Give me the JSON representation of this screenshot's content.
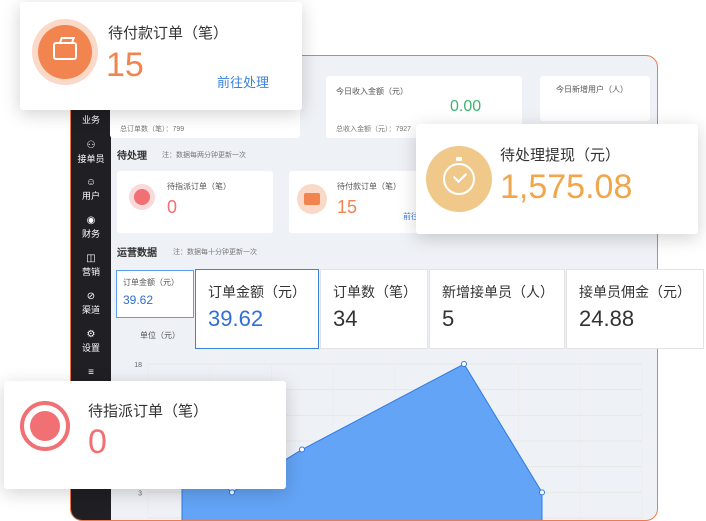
{
  "sidebar": {
    "items": [
      {
        "label": "业务",
        "glyph": "▣"
      },
      {
        "label": "接单员",
        "glyph": "⚇"
      },
      {
        "label": "用户",
        "glyph": "☺"
      },
      {
        "label": "财务",
        "glyph": "◉"
      },
      {
        "label": "营销",
        "glyph": "◫"
      },
      {
        "label": "渠道",
        "glyph": "⊘"
      },
      {
        "label": "设置",
        "glyph": "⚙"
      },
      {
        "label": "",
        "glyph": "≡"
      }
    ]
  },
  "top_stats": {
    "today_income_label": "今日收入金额（元）",
    "today_income_value": "0.00",
    "total_income_label": "总收入金额（元）：7927",
    "total_orders_label": "总订单数（笔）：799",
    "new_users_label": "今日新增用户（人）"
  },
  "pending": {
    "title": "待处理",
    "note": "注：数据每两分钟更新一次",
    "dispatch_label": "待指派订单（笔）",
    "dispatch_value": "0",
    "payment_label": "待付款订单（笔）",
    "payment_value": "15",
    "link_partial": "前往"
  },
  "ops": {
    "title": "运营数据",
    "note": "注：数据每十分钟更新一次",
    "small_tab_label": "订单金额（元）",
    "small_tab_value": "39.62",
    "unit_label": "单位（元）"
  },
  "callout_payment": {
    "label": "待付款订单（笔）",
    "value": "15",
    "link": "前往处理",
    "icon": "wallet-icon",
    "accent": "#f2844f"
  },
  "callout_withdraw": {
    "label": "待处理提现（元）",
    "value": "1,575.08",
    "icon": "timer-check-icon",
    "accent": "#f0a64b"
  },
  "callout_dispatch": {
    "label": "待指派订单（笔）",
    "value": "0",
    "icon": "stopwatch-icon",
    "accent": "#f07073"
  },
  "metrics": [
    {
      "label": "订单金额（元）",
      "value": "39.62"
    },
    {
      "label": "订单数（笔）",
      "value": "34"
    },
    {
      "label": "新增接单员（人）",
      "value": "5"
    },
    {
      "label": "接单员佣金（元）",
      "value": "24.88"
    }
  ],
  "chart_data": {
    "type": "area",
    "y_ticks": [
      "18",
      "3"
    ],
    "values": [
      8,
      3,
      8,
      18,
      3
    ],
    "ylim": [
      0,
      18
    ],
    "color": "#5b9ff5"
  }
}
